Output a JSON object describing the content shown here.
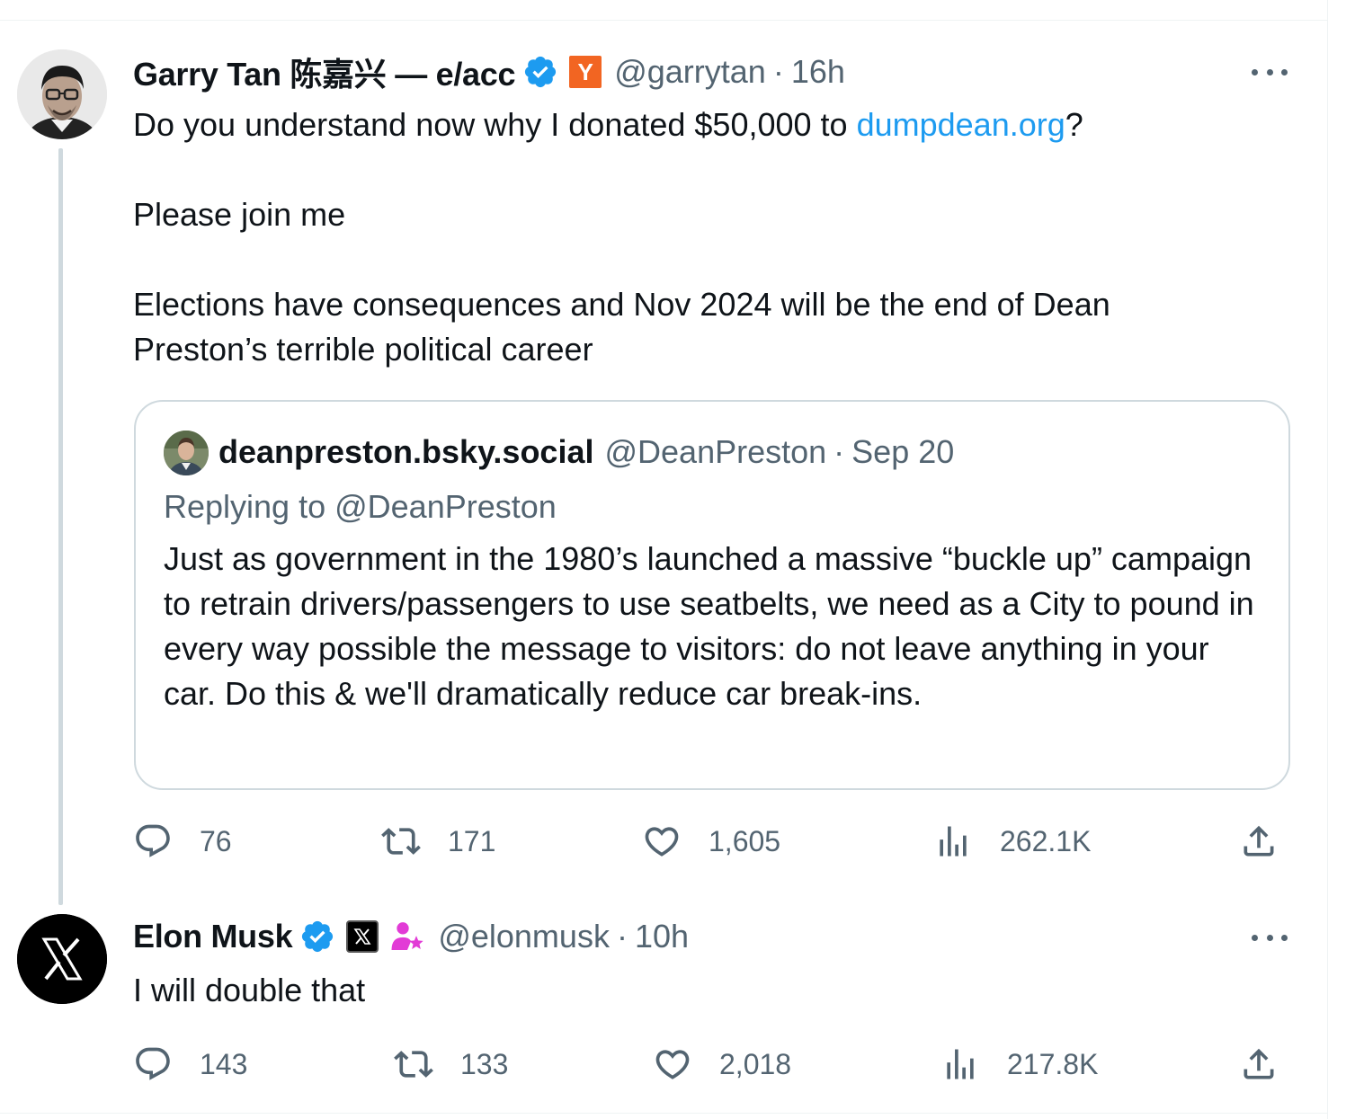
{
  "tweets": [
    {
      "display_name": "Garry Tan 陈嘉兴 — e/acc",
      "handle": "@garrytan",
      "dot": "·",
      "time": "16h",
      "badge_letter": "Y",
      "text_part1": "Do you understand now why I donated $50,000 to ",
      "link": "dumpdean.org",
      "text_part1_end": "?",
      "text_p2": "Please join me",
      "text_p3": "Elections have consequences and Nov 2024 will be the end of Dean Preston’s terrible political career",
      "quote": {
        "display_name": "deanpreston.bsky.social",
        "handle": "@DeanPreston",
        "dot": "·",
        "time": "Sep 20",
        "replying_to": "Replying to @DeanPreston",
        "text": "Just as government in the 1980’s launched a massive “buckle up” campaign to retrain drivers/passengers to use seatbelts, we need as a City to pound in every way possible the message to visitors: do not leave anything in your car. Do this & we'll dramatically reduce car break-ins."
      },
      "stats": {
        "replies": "76",
        "retweets": "171",
        "likes": "1,605",
        "views": "262.1K"
      }
    },
    {
      "display_name": "Elon Musk",
      "handle": "@elonmusk",
      "dot": "·",
      "time": "10h",
      "text": "I will double that",
      "stats": {
        "replies": "143",
        "retweets": "133",
        "likes": "2,018",
        "views": "217.8K"
      }
    }
  ],
  "colors": {
    "link": "#1d9bf0",
    "secondary_text": "#536471",
    "verified": "#1d9bf0",
    "yc_orange": "#f26522",
    "border": "#cfd9de"
  },
  "icons": [
    "verified-icon",
    "yc-badge-icon",
    "x-badge-icon",
    "person-star-icon",
    "reply-icon",
    "retweet-icon",
    "like-icon",
    "views-icon",
    "share-icon",
    "more-icon"
  ]
}
